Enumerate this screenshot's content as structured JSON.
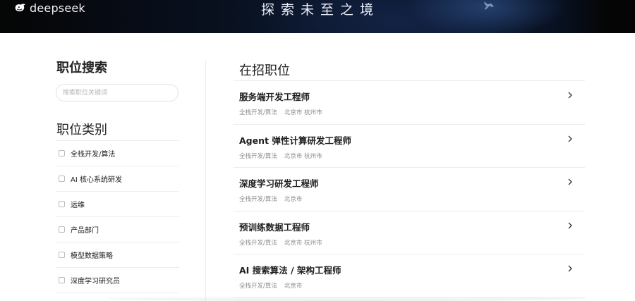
{
  "header": {
    "logo_text": "deepseek",
    "slogan": "探索未至之境"
  },
  "search": {
    "title": "职位搜索",
    "placeholder": "搜索职位关键词"
  },
  "categories": {
    "title": "职位类别",
    "items": [
      {
        "label": "全栈开发/算法"
      },
      {
        "label": "AI 核心系统研发"
      },
      {
        "label": "运维"
      },
      {
        "label": "产品部门"
      },
      {
        "label": "模型数据策略"
      },
      {
        "label": "深度学习研究员"
      }
    ]
  },
  "jobs": {
    "title": "在招职位",
    "items": [
      {
        "title": "服务端开发工程师",
        "category": "全栈开发/算法",
        "location": "北京市 杭州市"
      },
      {
        "title": "Agent 弹性计算研发工程师",
        "category": "全栈开发/算法",
        "location": "北京市 杭州市"
      },
      {
        "title": "深度学习研发工程师",
        "category": "全栈开发/算法",
        "location": "北京市"
      },
      {
        "title": "预训练数据工程师",
        "category": "全栈开发/算法",
        "location": "北京市 杭州市"
      },
      {
        "title": "AI 搜索算法 / 架构工程师",
        "category": "全栈开发/算法",
        "location": "北京市"
      }
    ]
  },
  "icons": {
    "logo": "whale-icon",
    "arrow": "chevron-right-icon",
    "checkbox": "checkbox-icon"
  }
}
